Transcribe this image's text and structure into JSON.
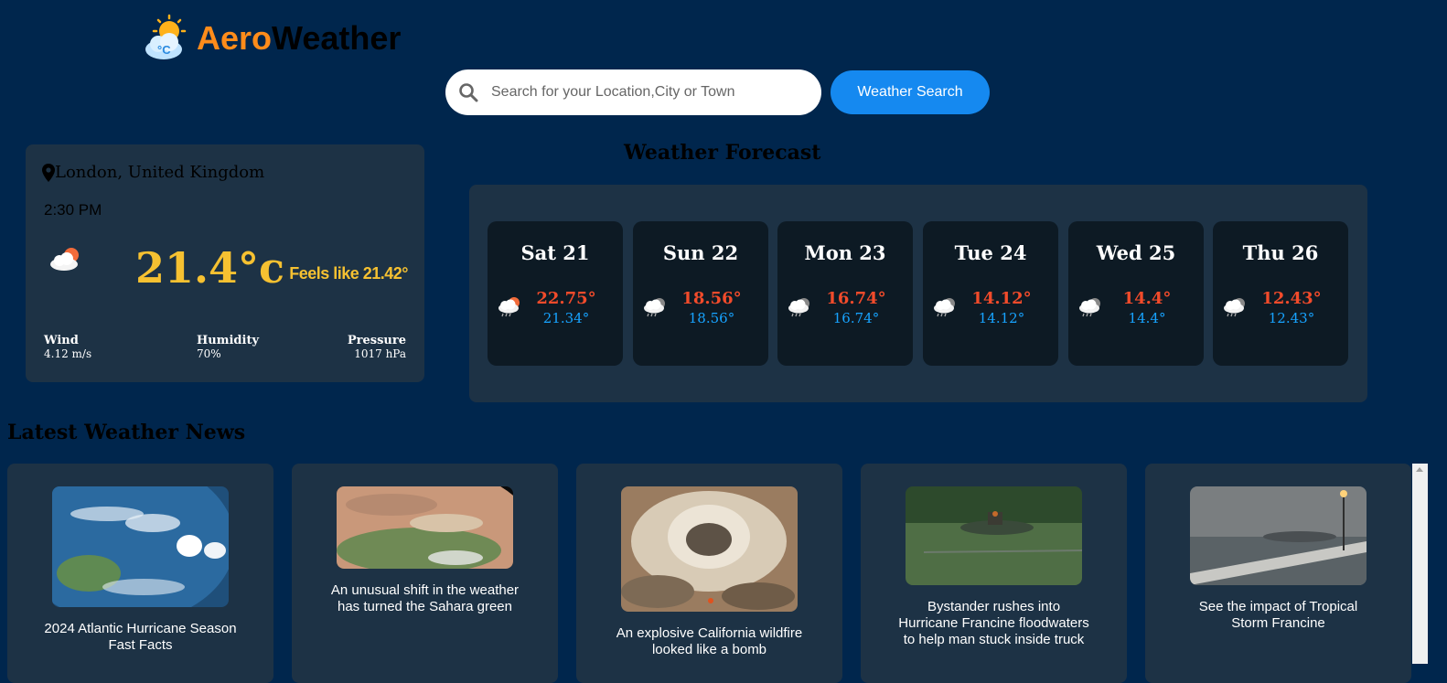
{
  "app": {
    "logo_part1": "Aero",
    "logo_part2": "Weather"
  },
  "search": {
    "placeholder": "Search for your Location,City or Town",
    "button_label": "Weather Search"
  },
  "current": {
    "location": "London, United Kingdom",
    "time": "2:30 PM",
    "temperature": "21.4°c",
    "feels_like": "Feels like 21.42°",
    "icon": "partly-cloudy-sun-icon",
    "stats": [
      {
        "label": "Wind",
        "value": "4.12 m/s"
      },
      {
        "label": "Humidity",
        "value": "70%"
      },
      {
        "label": "Pressure",
        "value": "1017 hPa"
      }
    ]
  },
  "forecast": {
    "title": "Weather Forecast",
    "days": [
      {
        "day": "Sat 21",
        "high": "22.75°",
        "low": "21.34°",
        "icon": "rain-sun-icon"
      },
      {
        "day": "Sun 22",
        "high": "18.56°",
        "low": "18.56°",
        "icon": "rain-cloud-icon"
      },
      {
        "day": "Mon 23",
        "high": "16.74°",
        "low": "16.74°",
        "icon": "rain-cloud-icon"
      },
      {
        "day": "Tue 24",
        "high": "14.12°",
        "low": "14.12°",
        "icon": "rain-cloud-icon"
      },
      {
        "day": "Wed 25",
        "high": "14.4°",
        "low": "14.4°",
        "icon": "rain-cloud-icon"
      },
      {
        "day": "Thu 26",
        "high": "12.43°",
        "low": "12.43°",
        "icon": "rain-cloud-icon"
      }
    ]
  },
  "news": {
    "heading": "Latest Weather News",
    "items": [
      {
        "title": "2024 Atlantic Hurricane Season Fast Facts"
      },
      {
        "title": "An unusual shift in the weather has turned the Sahara green"
      },
      {
        "title": "An explosive California wildfire looked like a bomb"
      },
      {
        "title": "Bystander rushes into Hurricane Francine floodwaters to help man stuck inside truck"
      },
      {
        "title": "See the impact of Tropical Storm Francine"
      }
    ]
  },
  "colors": {
    "background": "#00264d",
    "card": "#1d3245",
    "accent": "#1589f0",
    "temp": "#f6c131",
    "high": "#f24b2b",
    "low": "#17a3ff"
  }
}
